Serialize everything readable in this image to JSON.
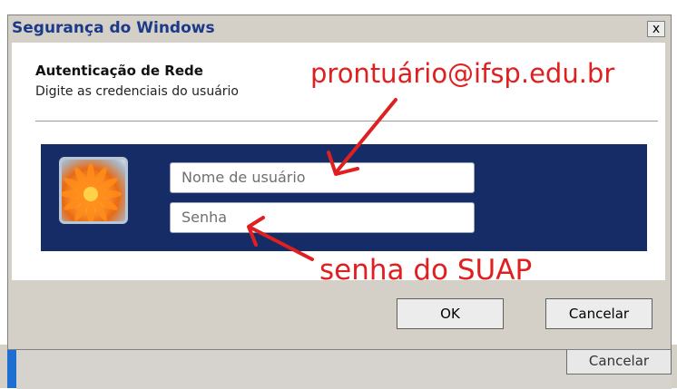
{
  "dialog": {
    "title": "Segurança do Windows",
    "close_label": "x",
    "heading": "Autenticação de Rede",
    "subheading": "Digite as credenciais do usuário",
    "username_placeholder": "Nome de usuário",
    "password_placeholder": "Senha",
    "ok_label": "OK",
    "cancel_label": "Cancelar"
  },
  "background_window": {
    "cancel_label": "Cancelar"
  },
  "annotations": {
    "username_hint": "prontuário@ifsp.edu.br",
    "password_hint": "senha do SUAP",
    "color": "#e02020"
  },
  "icons": {
    "avatar": "user-avatar-flower-icon",
    "close": "close-icon"
  }
}
